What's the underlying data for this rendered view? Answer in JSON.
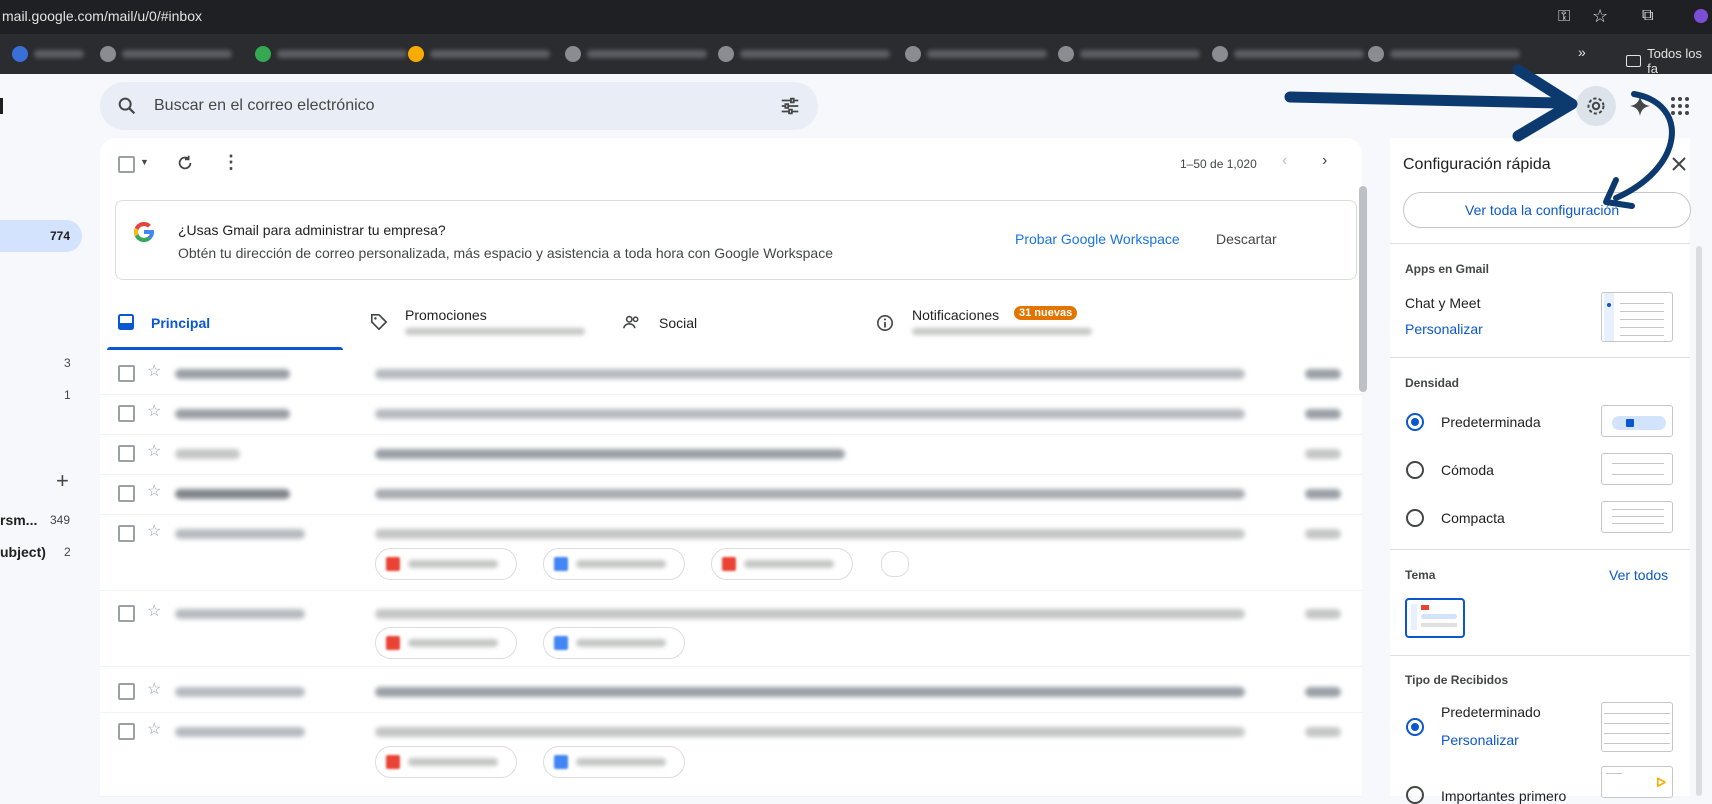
{
  "browser": {
    "url": "mail.google.com/mail/u/0/#inbox",
    "bookmarks_folder": "Todos los fa"
  },
  "search": {
    "placeholder": "Buscar en el correo electrónico"
  },
  "toolbar": {
    "pagination": "1–50 de 1,020"
  },
  "sidebar": {
    "inbox_count": "774",
    "counts": [
      "3",
      "1"
    ],
    "label_partial_1": "rsm...",
    "label_partial_1_count": "349",
    "label_partial_2": "ubject)",
    "label_partial_2_count": "2"
  },
  "promo": {
    "title": "¿Usas Gmail para administrar tu empresa?",
    "subtitle": "Obtén tu dirección de correo personalizada, más espacio y asistencia a toda hora con Google Workspace",
    "try_label": "Probar Google Workspace",
    "dismiss_label": "Descartar"
  },
  "tabs": [
    {
      "label": "Principal"
    },
    {
      "label": "Promociones"
    },
    {
      "label": "Social"
    },
    {
      "label": "Notificaciones",
      "badge": "31 nuevas"
    }
  ],
  "quick_settings": {
    "title": "Configuración rápida",
    "see_all_button": "Ver toda la configuración",
    "apps_section": "Apps en Gmail",
    "chat_meet": "Chat y Meet",
    "personalize": "Personalizar",
    "density_section": "Densidad",
    "density_options": [
      "Predeterminada",
      "Cómoda",
      "Compacta"
    ],
    "theme_section": "Tema",
    "theme_see_all": "Ver todos",
    "inbox_type_section": "Tipo de Recibidos",
    "inbox_type_default": "Predeterminado",
    "inbox_type_personalize": "Personalizar",
    "inbox_type_important": "Importantes primero"
  },
  "colors": {
    "accent": "#0b57d0",
    "badge": "#e37400",
    "arrow": "#0d3a6e",
    "link": "#1a73e8"
  }
}
